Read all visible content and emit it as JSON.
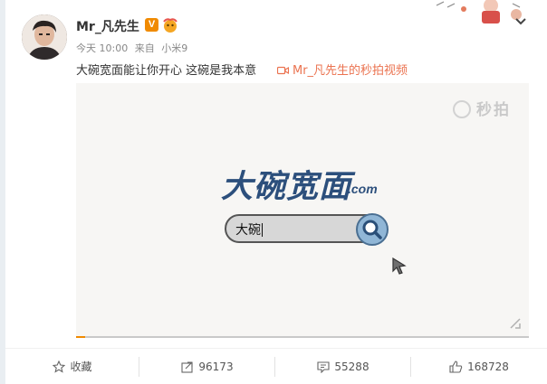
{
  "post": {
    "username": "Mr_凡先生",
    "verified_badge": "V",
    "time": "今天 10:00",
    "source_prefix": "来自",
    "source": "小米9",
    "text": "大碗宽面能让你开心 这碗是我本意",
    "video_link": "Mr_凡先生的秒拍视频",
    "link_color": "#eb7350"
  },
  "video": {
    "watermark": "秒拍",
    "logo": "大碗宽面",
    "logo_suffix": ".com",
    "search_text": "大碗",
    "progress": 0.004
  },
  "actions": {
    "favorite_label": "收藏",
    "repost_count": "96173",
    "comment_count": "55288",
    "like_count": "168728"
  },
  "icons": [
    "avatar",
    "verified-badge",
    "emoji-badge",
    "chevron-down-icon",
    "video-camera-icon",
    "search-icon",
    "cursor-icon",
    "fullscreen-icon",
    "star-icon",
    "repost-icon",
    "comment-icon",
    "like-icon"
  ]
}
